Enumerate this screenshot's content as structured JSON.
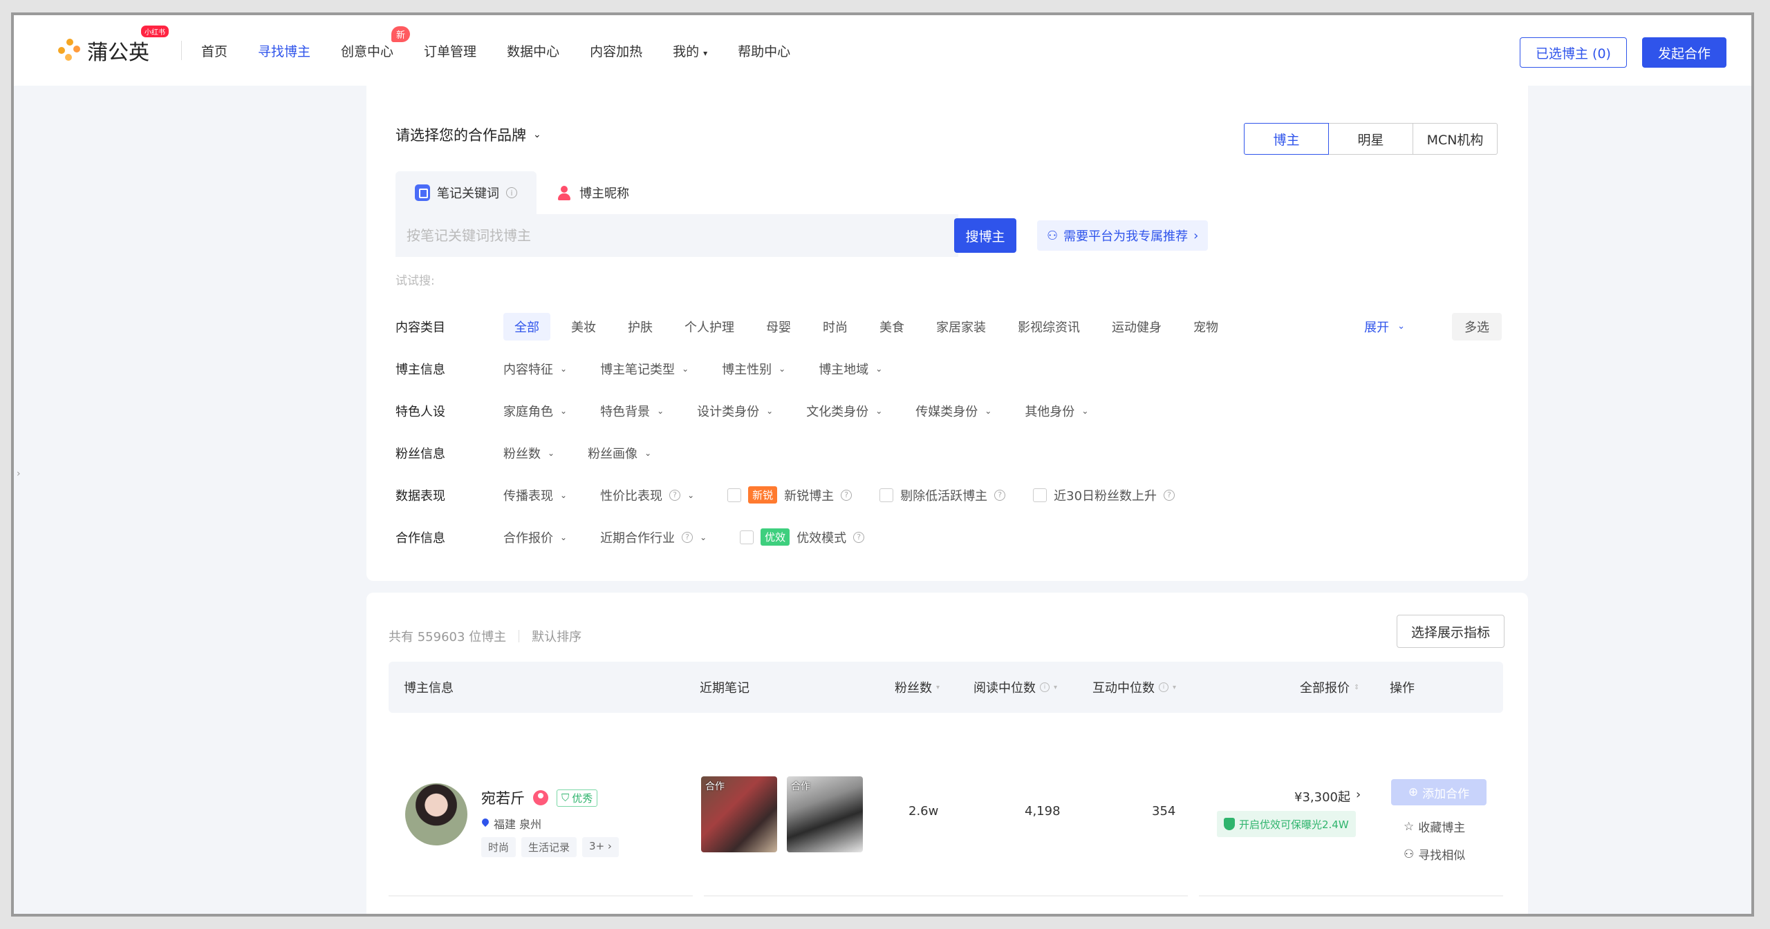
{
  "header": {
    "logo_text": "蒲公英",
    "logo_badge": "小红书",
    "nav": [
      {
        "label": "首页",
        "active": false
      },
      {
        "label": "寻找博主",
        "active": true
      },
      {
        "label": "创意中心",
        "active": false,
        "badge": "新"
      },
      {
        "label": "订单管理",
        "active": false
      },
      {
        "label": "数据中心",
        "active": false
      },
      {
        "label": "内容加热",
        "active": false
      },
      {
        "label": "我的",
        "active": false,
        "caret": "▾"
      },
      {
        "label": "帮助中心",
        "active": false
      }
    ],
    "selected_btn": "已选博主 (0)",
    "start_btn": "发起合作"
  },
  "filter": {
    "brand_select": "请选择您的合作品牌",
    "types": [
      "博主",
      "明星",
      "MCN机构"
    ],
    "active_type": 0,
    "tabs": [
      {
        "label": "笔记关键词",
        "icon": "note-icon"
      },
      {
        "label": "博主昵称",
        "icon": "user-icon"
      }
    ],
    "search_placeholder": "按笔记关键词找博主",
    "search_btn": "搜博主",
    "recommend_btn": "需要平台为我专属推荐",
    "try_label": "试试搜:",
    "rows": {
      "content_category": {
        "label": "内容类目",
        "chips": [
          "全部",
          "美妆",
          "护肤",
          "个人护理",
          "母婴",
          "时尚",
          "美食",
          "家居家装",
          "影视综资讯",
          "运动健身",
          "宠物"
        ],
        "expand": "展开",
        "multi": "多选"
      },
      "blogger_info": {
        "label": "博主信息",
        "dropdowns": [
          "内容特征",
          "博主笔记类型",
          "博主性别",
          "博主地域"
        ]
      },
      "persona": {
        "label": "特色人设",
        "dropdowns": [
          "家庭角色",
          "特色背景",
          "设计类身份",
          "文化类身份",
          "传媒类身份",
          "其他身份"
        ]
      },
      "fans": {
        "label": "粉丝信息",
        "dropdowns": [
          "粉丝数",
          "粉丝画像"
        ]
      },
      "data_perf": {
        "label": "数据表现",
        "dropdowns": [
          "传播表现",
          "性价比表现"
        ],
        "checks": [
          {
            "tag": "新锐",
            "label": "新锐博主"
          },
          {
            "tag": "",
            "label": "剔除低活跃博主"
          },
          {
            "tag": "",
            "label": "近30日粉丝数上升"
          }
        ]
      },
      "coop": {
        "label": "合作信息",
        "dropdowns": [
          "合作报价",
          "近期合作行业"
        ],
        "checks": [
          {
            "tag": "优效",
            "label": "优效模式"
          }
        ]
      }
    }
  },
  "results": {
    "total": "共有 559603 位博主",
    "sort": "默认排序",
    "metrics_btn": "选择展示指标",
    "columns": [
      "博主信息",
      "近期笔记",
      "粉丝数",
      "阅读中位数",
      "互动中位数",
      "全部报价",
      "操作"
    ],
    "rows": [
      {
        "name": "宛若斤",
        "quality": "优秀",
        "location": "福建 泉州",
        "tags": [
          "时尚",
          "生活记录",
          "3+ ›"
        ],
        "notes": [
          "合作",
          "合作"
        ],
        "fans": "2.6w",
        "read_median": "4,198",
        "interact_median": "354",
        "price": "¥3,300起",
        "boost": "开启优效可保曝光2.4W",
        "add_btn": "添加合作",
        "collect": "收藏博主",
        "similar": "寻找相似"
      }
    ]
  },
  "colors": {
    "accent": "#2f54eb",
    "success": "#2fb46d",
    "badge_red": "#ff2442"
  }
}
